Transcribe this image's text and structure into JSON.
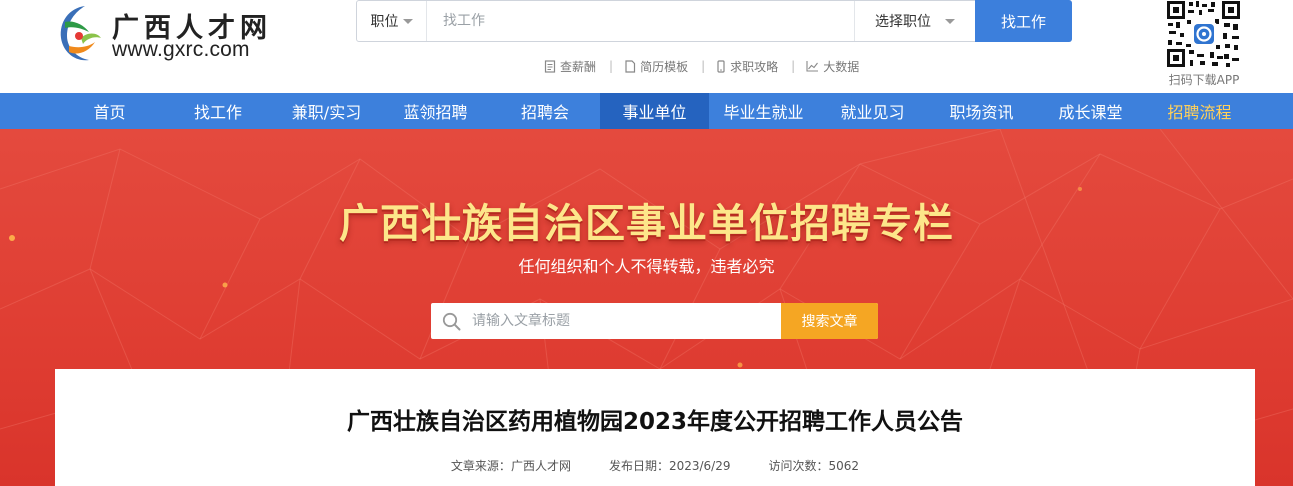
{
  "site": {
    "logo_title": "广西人才网",
    "logo_url": "www.gxrc.com"
  },
  "search": {
    "category": "职位",
    "placeholder": "找工作",
    "select_label": "选择职位",
    "button": "找工作"
  },
  "tools": [
    {
      "label": "查薪酬",
      "icon": "document-icon"
    },
    {
      "label": "简历模板",
      "icon": "file-icon"
    },
    {
      "label": "求职攻略",
      "icon": "phone-icon"
    },
    {
      "label": "大数据",
      "icon": "chart-line-icon"
    }
  ],
  "qr": {
    "caption": "扫码下载APP"
  },
  "nav": {
    "items": [
      {
        "label": "首页"
      },
      {
        "label": "找工作"
      },
      {
        "label": "兼职/实习"
      },
      {
        "label": "蓝领招聘"
      },
      {
        "label": "招聘会"
      },
      {
        "label": "事业单位",
        "active": true
      },
      {
        "label": "毕业生就业"
      },
      {
        "label": "就业见习"
      },
      {
        "label": "职场资讯"
      },
      {
        "label": "成长课堂"
      },
      {
        "label": "招聘流程",
        "highlight": true
      }
    ]
  },
  "banner": {
    "title": "广西壮族自治区事业单位招聘专栏",
    "subtitle": "任何组织和个人不得转载，违者必究",
    "search_placeholder": "请输入文章标题",
    "search_button": "搜索文章"
  },
  "article": {
    "title": "广西壮族自治区药用植物园2023年度公开招聘工作人员公告",
    "source_label": "文章来源：",
    "source": "广西人才网",
    "date_label": "发布日期：",
    "date": "2023/6/29",
    "views_label": "访问次数：",
    "views": "5062"
  },
  "colors": {
    "nav_blue": "#3d80dc",
    "nav_active": "#2563bf",
    "banner_red": "#e0412f",
    "title_yellow": "#fde68a",
    "accent_orange": "#f5a623"
  }
}
